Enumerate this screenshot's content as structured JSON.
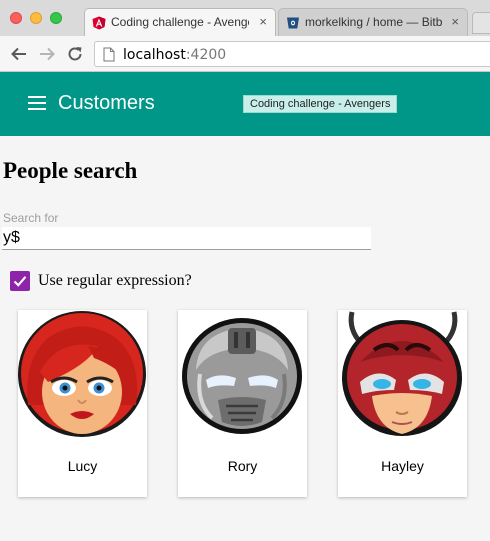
{
  "browser": {
    "tabs": [
      {
        "title": "Coding challenge - Avengers",
        "close": "×",
        "favicon": "angular-icon"
      },
      {
        "title": "morkelking / home — Bitbucket",
        "close": "×",
        "favicon": "bitbucket-icon"
      }
    ],
    "url": {
      "host": "localhost",
      "port": ":4200"
    }
  },
  "appbar": {
    "title": "Customers",
    "badge": "Coding challenge - Avengers",
    "color": "#009688"
  },
  "search": {
    "heading": "People search",
    "label": "Search for",
    "value": "y$",
    "regex_label": "Use regular expression?",
    "regex_checked": true,
    "checkbox_color": "#8e24aa"
  },
  "people": [
    {
      "name": "Lucy",
      "avatar": "red-haired-woman-avatar"
    },
    {
      "name": "Rory",
      "avatar": "war-machine-helmet-avatar"
    },
    {
      "name": "Hayley",
      "avatar": "ant-helmet-avatar"
    }
  ]
}
